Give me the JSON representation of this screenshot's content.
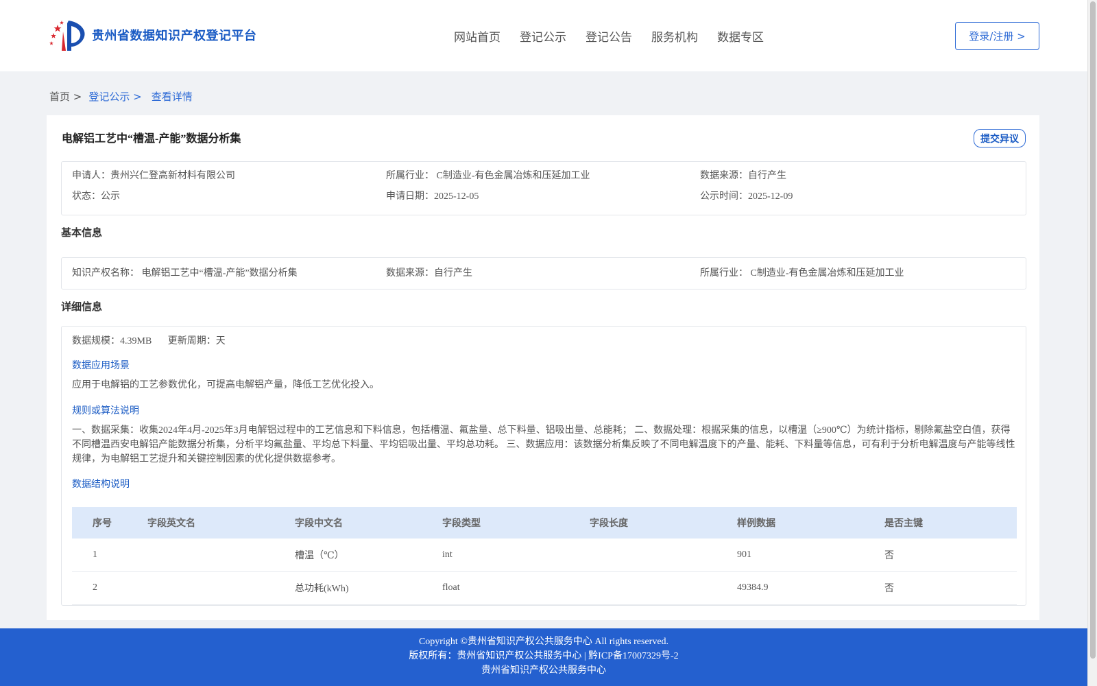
{
  "header": {
    "site_title": "贵州省数据知识产权登记平台",
    "nav": [
      "网站首页",
      "登记公示",
      "登记公告",
      "服务机构",
      "数据专区"
    ],
    "login_label": "登录/注册 >"
  },
  "breadcrumb": {
    "home": "首页 >",
    "section": "登记公示 >",
    "current": "查看详情"
  },
  "record": {
    "title": "电解铝工艺中“槽温-产能”数据分析集",
    "objection_label": "提交异议",
    "summary": {
      "applicant": "申请人：贵州兴仁登高新材料有限公司",
      "industry": "所属行业： C制造业-有色金属冶炼和压延加工业",
      "source": "数据来源：自行产生",
      "status": "状态：公示",
      "apply_date": "申请日期：2025-12-05",
      "publish_date": "公示时间：2025-12-09"
    }
  },
  "basic_info": {
    "section_title": "基本信息",
    "ip_name": "知识产权名称： 电解铝工艺中“槽温-产能”数据分析集",
    "source": "数据来源：自行产生",
    "industry": "所属行业： C制造业-有色金属冶炼和压延加工业"
  },
  "detail_info": {
    "section_title": "详细信息",
    "scale": "数据规模：4.39MB",
    "update_cycle": "更新周期：天",
    "scenario_title": "数据应用场景",
    "scenario_text": "应用于电解铝的工艺参数优化，可提高电解铝产量，降低工艺优化投入。",
    "algorithm_title": "规则或算法说明",
    "algorithm_text": "一、数据采集：收集2024年4月-2025年3月电解铝过程中的工艺信息和下料信息，包括槽温、氟盐量、总下料量、铝吸出量、总能耗； 二、数据处理：根据采集的信息，以槽温（≥900℃）为统计指标，剔除氟盐空白值，获得不同槽温西安电解铝产能数据分析集，分析平均氟盐量、平均总下料量、平均铝吸出量、平均总功耗。 三、数据应用：该数据分析集反映了不同电解温度下的产量、能耗、下料量等信息，可有利于分析电解温度与产能等线性规律，为电解铝工艺提升和关键控制因素的优化提供数据参考。",
    "structure_title": "数据结构说明",
    "table": {
      "headers": [
        "序号",
        "字段英文名",
        "字段中文名",
        "字段类型",
        "字段长度",
        "样例数据",
        "是否主键"
      ],
      "rows": [
        [
          "1",
          "",
          "槽温（℃）",
          "int",
          "",
          "901",
          "否"
        ],
        [
          "2",
          "",
          "总功耗(kWh)",
          "float",
          "",
          "49384.9",
          "否"
        ]
      ]
    }
  },
  "footer": {
    "copyright": "Copyright ©贵州省知识产权公共服务中心 All rights reserved.",
    "owner": "版权所有：贵州省知识产权公共服务中心 | 黔ICP备17007329号-2",
    "org": "贵州省知识产权公共服务中心"
  }
}
